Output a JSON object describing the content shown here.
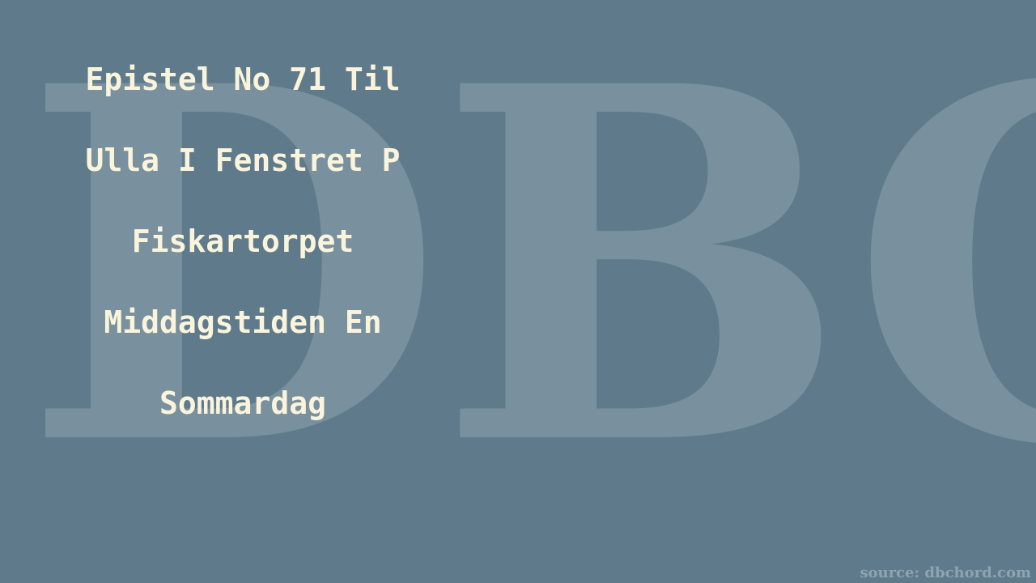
{
  "watermark": "DBC",
  "title_lines": [
    "Epistel No 71 Til",
    "Ulla I Fenstret P",
    "Fiskartorpet",
    "Middagstiden En",
    "Sommardag"
  ],
  "source": "source: dbchord.com",
  "colors": {
    "background": "#5f7b8b",
    "title_text": "#fbf4dc",
    "watermark": "#ffffff",
    "source_text": "#8da4b1"
  }
}
